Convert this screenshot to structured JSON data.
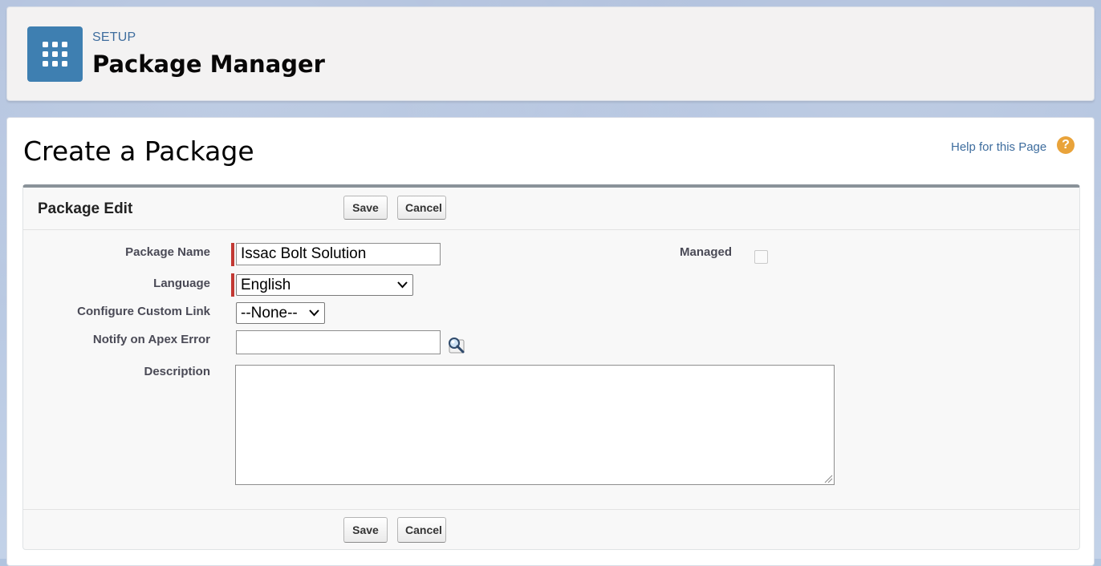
{
  "header": {
    "eyebrow": "SETUP",
    "title": "Package Manager",
    "icon": "app-grid-icon",
    "icon_color": "#3e7fb1"
  },
  "page": {
    "title": "Create a Package",
    "help_link": "Help for this Page",
    "help_icon": "question-icon"
  },
  "edit_block": {
    "title": "Package Edit",
    "save_label": "Save",
    "cancel_label": "Cancel"
  },
  "fields": {
    "package_name": {
      "label": "Package Name",
      "value": "Issac Bolt Solution",
      "required": true
    },
    "language": {
      "label": "Language",
      "value": "English",
      "required": true
    },
    "custom_link": {
      "label": "Configure Custom Link",
      "value": "--None--"
    },
    "notify_apex": {
      "label": "Notify on Apex Error",
      "value": "",
      "lookup_icon": "magnifier-lookup-icon"
    },
    "description": {
      "label": "Description",
      "value": ""
    },
    "managed": {
      "label": "Managed",
      "checked": false
    }
  },
  "colors": {
    "required_indicator": "#c23934",
    "link": "#3e6d9e",
    "help_icon": "#e9a33a"
  }
}
